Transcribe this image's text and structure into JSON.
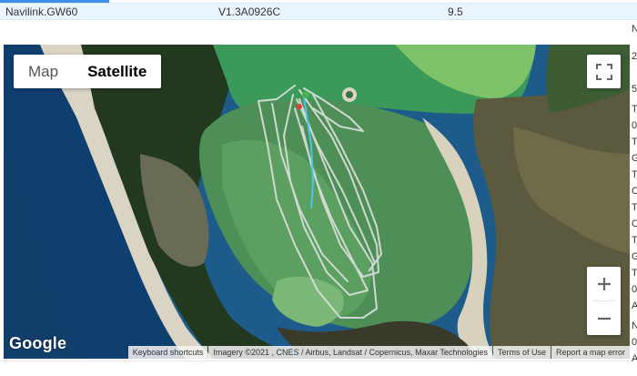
{
  "info_row": {
    "device": "Navilink.GW60",
    "version": "V1.3A0926C",
    "value": "9.5"
  },
  "map": {
    "type_control": {
      "map_label": "Map",
      "satellite_label": "Satellite",
      "selected": "Satellite"
    },
    "logo": "Google",
    "attribution": {
      "shortcuts": "Keyboard shortcuts",
      "imagery": "Imagery ©2021 , CNES / Airbus, Landsat / Copernicus, Maxar Technologies",
      "terms": "Terms of Use",
      "report": "Report a map error"
    },
    "icons": {
      "fullscreen": "fullscreen-icon",
      "zoom_in": "plus-icon",
      "zoom_out": "minus-icon"
    },
    "colors": {
      "track": "#d8dcd9",
      "highlight_track": "#4fc3e8",
      "start_marker": "#4caf50",
      "end_marker": "#e53935"
    }
  },
  "right_strip": [
    "N",
    "2",
    "5",
    "T",
    "0",
    "T",
    "G",
    "T",
    "C",
    "T",
    "C",
    "T",
    "G",
    "T",
    "0",
    "A",
    "N",
    "0",
    "A"
  ]
}
